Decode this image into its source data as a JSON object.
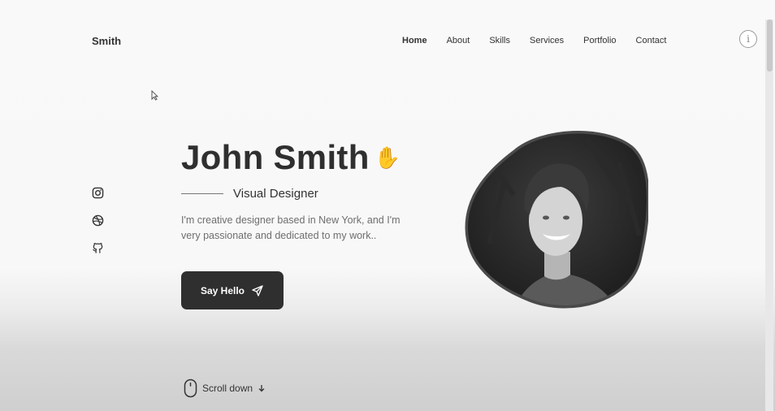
{
  "brand": "Smith",
  "nav": {
    "items": [
      "Home",
      "About",
      "Skills",
      "Services",
      "Portfolio",
      "Contact"
    ],
    "active": "Home"
  },
  "hero": {
    "title": "John Smith",
    "subtitle": "Visual Designer",
    "description_line1": "I'm creative designer based in New York, and I'm",
    "description_line2": "very passionate and dedicated to my work..",
    "cta_label": "Say Hello",
    "scroll_label": "Scroll down"
  },
  "social_icons": [
    "instagram-icon",
    "dribbble-icon",
    "github-icon"
  ],
  "colors": {
    "text": "#2f2f2f",
    "button_bg": "#2f2f2f",
    "wave_emoji": "#f4c14d",
    "background": "#f9f9f9"
  }
}
